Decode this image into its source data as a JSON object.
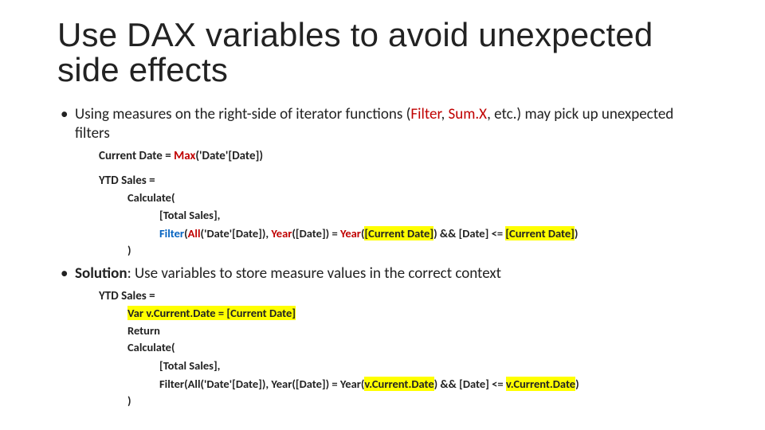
{
  "title": "Use DAX variables to avoid unexpected side effects",
  "bullet1": {
    "pre": "Using measures on the right-side of iterator functions (",
    "fn1": "Filter",
    "sep1": ", ",
    "fn2": "Sum.X",
    "rest": ", etc.) may pick up unexpected filters"
  },
  "ex1": {
    "cd_label": "Current Date = ",
    "cd_fn": "Max",
    "cd_arg": "('Date'[Date])",
    "ytd_label": "YTD Sales =",
    "calc_open": "Calculate(",
    "total": "[Total Sales],",
    "filter_fn": "Filter",
    "filter_open": "(",
    "all_fn": "All",
    "all_arg": "('Date'[Date]), ",
    "year_fn": "Year",
    "year_arg1": "([Date]) = ",
    "year_fn2": "Year",
    "year_open2": "(",
    "cur1": "[Current Date]",
    "year_close2": ")",
    "and": " && [Date] <= ",
    "cur2": "[Current Date]",
    "filter_close": ")",
    "calc_close": ")"
  },
  "bullet2": {
    "sol": "Solution",
    "rest": ": Use variables to store measure values in the correct context"
  },
  "ex2": {
    "ytd_label": "YTD Sales =",
    "var": "Var ",
    "vname": "v.Current.Date",
    "veq": " = ",
    "vval": "[Current Date]",
    "ret": "Return",
    "calc_open": "Calculate(",
    "total": "[Total Sales],",
    "filter": "Filter(All('Date'[Date]), Year([Date]) = Year(",
    "v1": "v.Current.Date",
    "mid": ") && [Date] <= ",
    "v2": "v.Current.Date",
    "close": ")",
    "calc_close": ")"
  }
}
